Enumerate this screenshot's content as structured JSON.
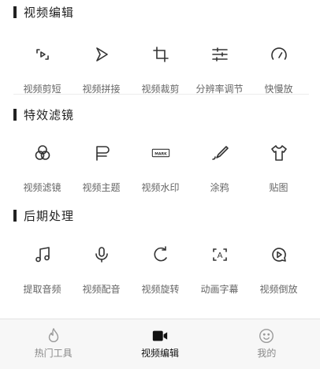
{
  "sections": [
    {
      "title": "视频编辑",
      "tools": [
        {
          "label": "视频剪短",
          "icon": "trim-icon"
        },
        {
          "label": "视频拼接",
          "icon": "play-outline-icon"
        },
        {
          "label": "视频裁剪",
          "icon": "crop-icon"
        },
        {
          "label": "分辨率调节",
          "icon": "adjust-sliders-icon"
        },
        {
          "label": "快慢放",
          "icon": "speedometer-icon"
        }
      ]
    },
    {
      "title": "特效滤镜",
      "tools": [
        {
          "label": "视频滤镜",
          "icon": "filter-circles-icon"
        },
        {
          "label": "视频主题",
          "icon": "flag-icon"
        },
        {
          "label": "视频水印",
          "icon": "watermark-icon",
          "badge": "MARK"
        },
        {
          "label": "涂鸦",
          "icon": "brush-icon"
        },
        {
          "label": "贴图",
          "icon": "tshirt-icon"
        }
      ]
    },
    {
      "title": "后期处理",
      "tools": [
        {
          "label": "提取音频",
          "icon": "music-note-icon"
        },
        {
          "label": "视频配音",
          "icon": "microphone-icon"
        },
        {
          "label": "视频旋转",
          "icon": "rotate-icon"
        },
        {
          "label": "动画字幕",
          "icon": "text-frame-icon",
          "badge": "A"
        },
        {
          "label": "视频倒放",
          "icon": "reverse-play-icon"
        }
      ]
    }
  ],
  "bottom_nav": [
    {
      "label": "热门工具",
      "icon": "flame-icon",
      "active": false
    },
    {
      "label": "视频编辑",
      "icon": "video-camera-icon",
      "active": true
    },
    {
      "label": "我的",
      "icon": "smiley-icon",
      "active": false
    }
  ],
  "colors": {
    "icon": "#333333",
    "label": "#666666",
    "active": "#111111",
    "nav_bg": "#f7f7f7"
  }
}
